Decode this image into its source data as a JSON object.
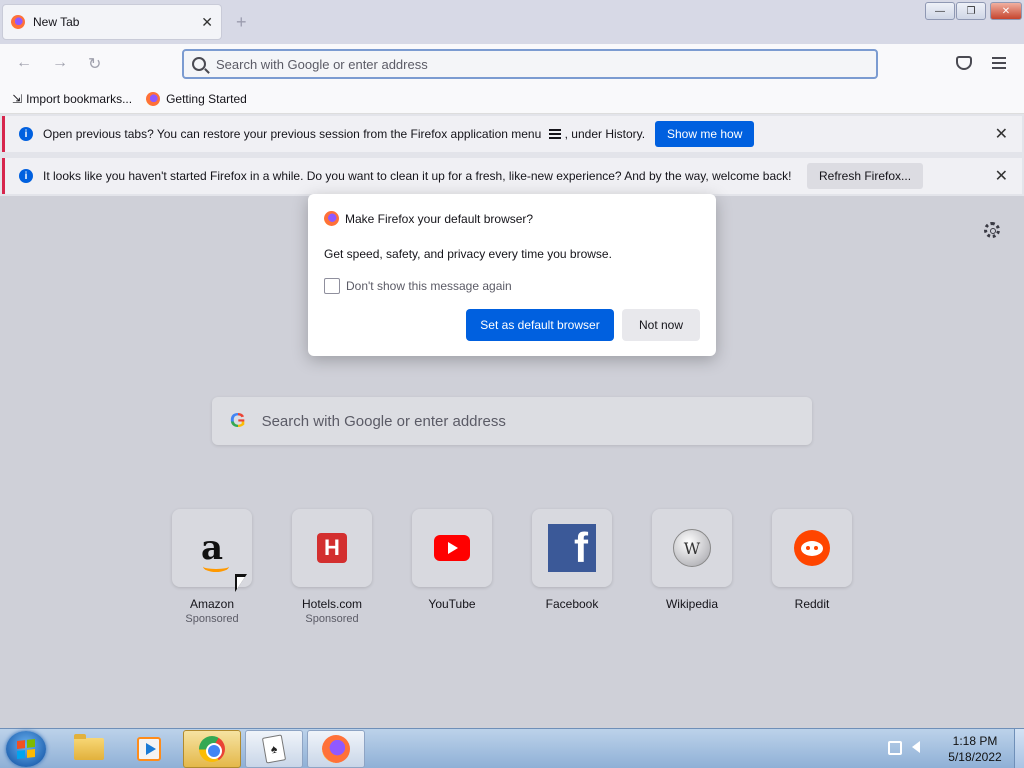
{
  "window": {
    "tab_title": "New Tab",
    "tab_close": "✕",
    "new_tab": "+",
    "controls": {
      "minimize": "—",
      "maximize": "❐",
      "close": "✕"
    }
  },
  "navbar": {
    "back": "←",
    "forward": "→",
    "reload": "↻",
    "url_placeholder": "Search with Google or enter address"
  },
  "bookmarks": [
    {
      "icon": "import-icon",
      "glyph": "⇲",
      "label": "Import bookmarks..."
    },
    {
      "icon": "firefox-icon",
      "label": "Getting Started"
    }
  ],
  "notifications": [
    {
      "message_before": "Open previous tabs? You can restore your previous session from the Firefox application menu",
      "message_after": ", under History.",
      "button": "Show me how",
      "close": "✕"
    },
    {
      "message": "It looks like you haven't started Firefox in a while. Do you want to clean it up for a fresh, like-new experience? And by the way, welcome back!",
      "button": "Refresh Firefox...",
      "close": "✕"
    }
  ],
  "dialog": {
    "title": "Make Firefox your default browser?",
    "body": "Get speed, safety, and privacy every time you browse.",
    "checkbox_label": "Don't show this message again",
    "checkbox_checked": false,
    "primary_button": "Set as default browser",
    "secondary_button": "Not now"
  },
  "newtab": {
    "search_placeholder": "Search with Google or enter address",
    "google_glyph": "G",
    "tiles": [
      {
        "name": "Amazon",
        "sub": "Sponsored",
        "icon": "amazon-icon",
        "glyph": "a"
      },
      {
        "name": "Hotels.com",
        "sub": "Sponsored",
        "icon": "hotels-icon",
        "glyph": "H"
      },
      {
        "name": "YouTube",
        "sub": "",
        "icon": "youtube-icon",
        "glyph": ""
      },
      {
        "name": "Facebook",
        "sub": "",
        "icon": "facebook-icon",
        "glyph": "f"
      },
      {
        "name": "Wikipedia",
        "sub": "",
        "icon": "wikipedia-icon",
        "glyph": "W"
      },
      {
        "name": "Reddit",
        "sub": "",
        "icon": "reddit-icon",
        "glyph": ""
      }
    ]
  },
  "taskbar": {
    "items": [
      {
        "icon": "explorer-icon",
        "state": "pinned"
      },
      {
        "icon": "media-player-icon",
        "state": "pinned"
      },
      {
        "icon": "chrome-icon",
        "state": "active"
      },
      {
        "icon": "solitaire-icon",
        "glyph": "♠",
        "state": "open"
      },
      {
        "icon": "firefox-icon",
        "state": "open"
      }
    ],
    "time": "1:18 PM",
    "date": "5/18/2022"
  },
  "colors": {
    "accent": "#0060df",
    "notification_stripe": "#d7264c",
    "taskbar_active": "#e4b84a"
  }
}
